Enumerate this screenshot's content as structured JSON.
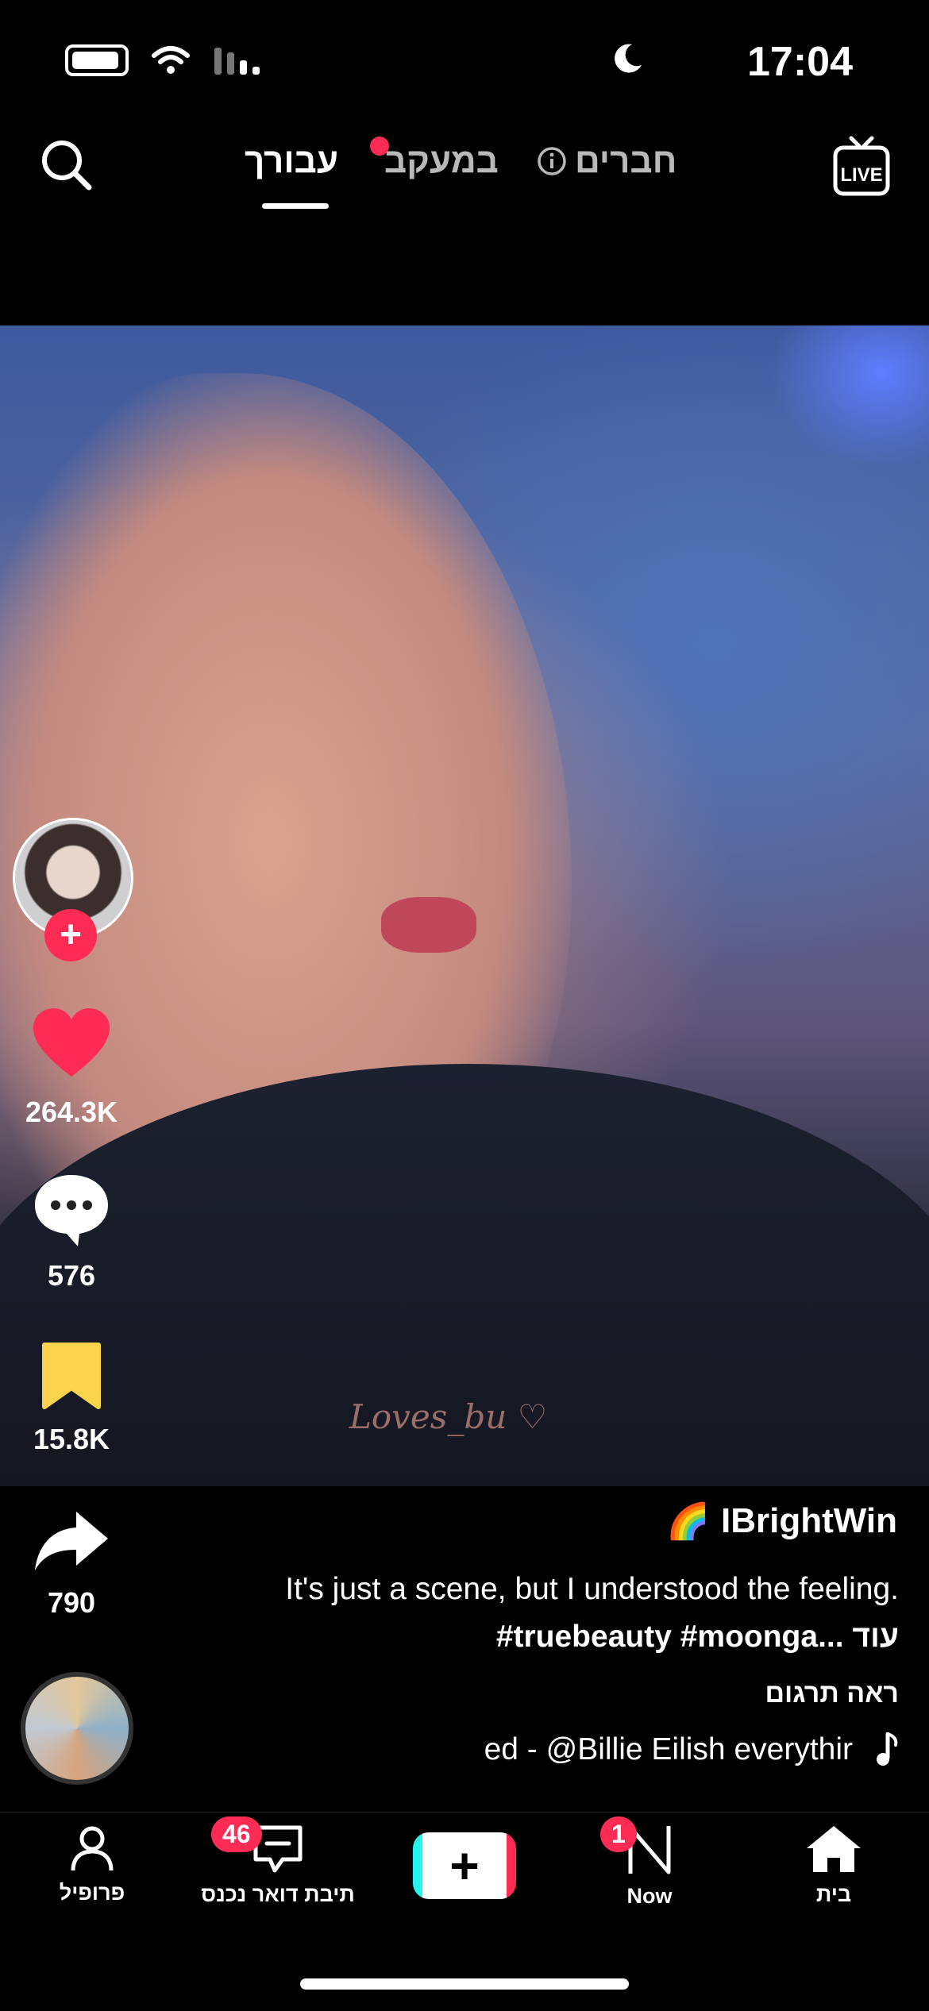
{
  "status_bar": {
    "time": "17:04"
  },
  "top_nav": {
    "tabs": [
      {
        "label": "עבורך",
        "active": true
      },
      {
        "label": "במעקב",
        "active": false
      },
      {
        "label": "חברים",
        "active": false
      }
    ],
    "live_label": "LIVE"
  },
  "video": {
    "watermark": "Loves_bu ♡"
  },
  "actions": {
    "likes": "264.3K",
    "comments": "576",
    "saves": "15.8K",
    "shares": "790"
  },
  "caption": {
    "username": "IBrightWin",
    "username_emoji": "🌈",
    "text": "It's just a scene, but I understood the feeling. ",
    "hashtags": "#truebeauty #moonga...",
    "more": "עוד",
    "translate": "ראה תרגום",
    "music": "ed - @Billie Eilish    everythir"
  },
  "bottom_nav": {
    "items": [
      {
        "label": "פרופיל"
      },
      {
        "label": "תיבת דואר נכנס",
        "badge": "46"
      },
      {
        "label": "Now",
        "badge": "1"
      },
      {
        "label": "בית"
      }
    ]
  },
  "colors": {
    "accent": "#fe2c55",
    "save": "#fcd34d",
    "cyan": "#25f4ee"
  }
}
